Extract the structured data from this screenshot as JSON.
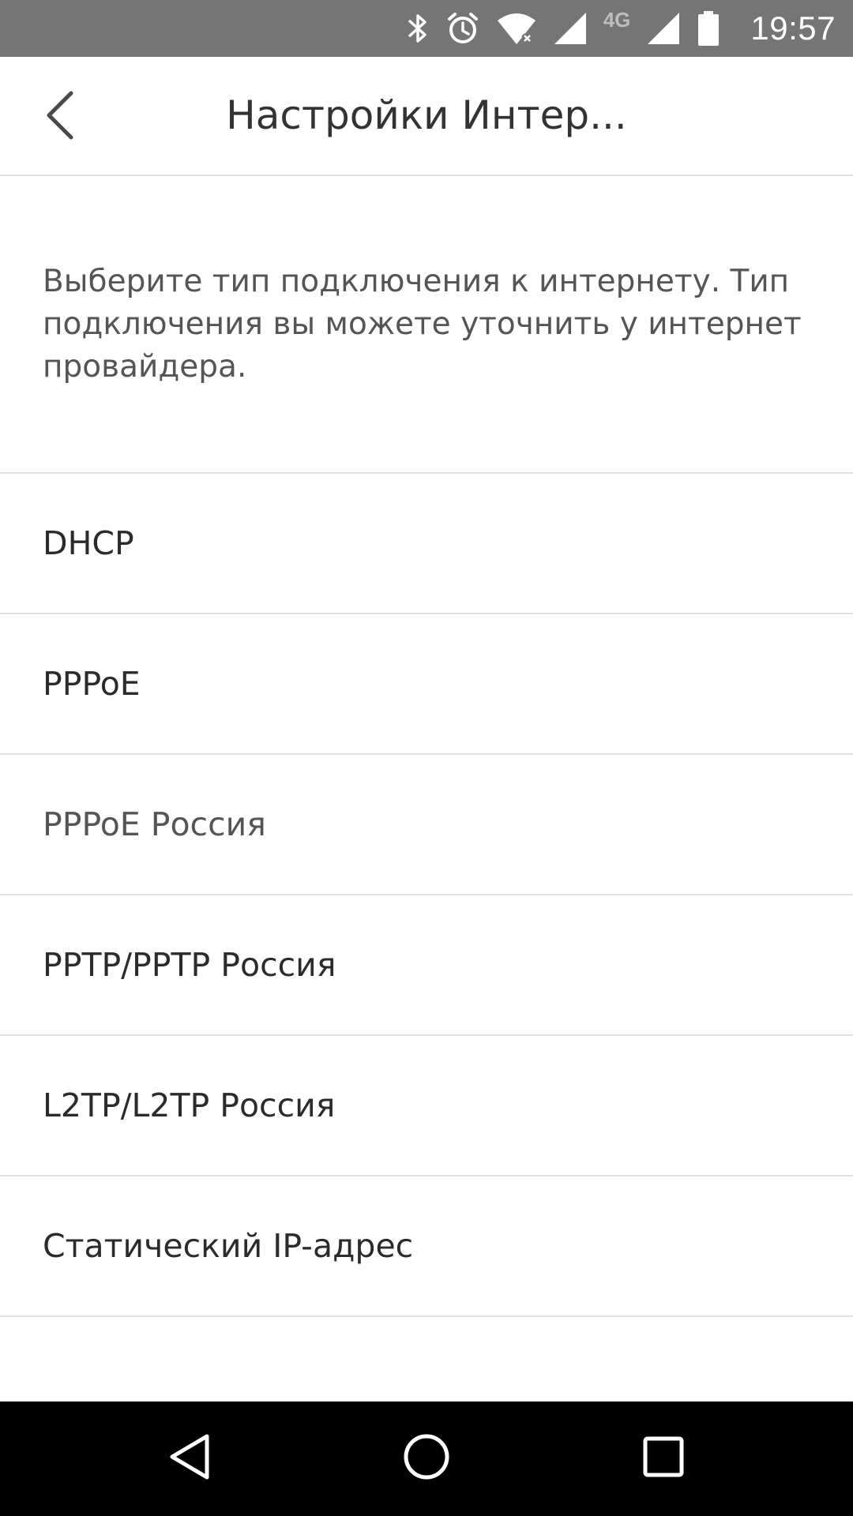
{
  "status_bar": {
    "time": "19:57",
    "network_label": "4G",
    "icons": [
      "bluetooth-icon",
      "alarm-icon",
      "wifi-icon",
      "signal-icon",
      "signal-icon",
      "battery-icon"
    ]
  },
  "app_bar": {
    "title": "Настройки Интер...",
    "back_icon": "chevron-left-icon"
  },
  "description": "Выберите тип подключения к интернету. Тип подключения вы можете уточнить у интернет провайдера.",
  "connection_types": [
    {
      "label": "DHCP"
    },
    {
      "label": "PPPoE"
    },
    {
      "label": "PPPoE Россия"
    },
    {
      "label": "PPTP/PPTP Россия"
    },
    {
      "label": "L2TP/L2TP Россия"
    },
    {
      "label": "Статический IP-адрес"
    }
  ],
  "nav_bar": {
    "icons": [
      "nav-back-icon",
      "nav-home-icon",
      "nav-recents-icon"
    ]
  },
  "colors": {
    "status_bar": "#757575",
    "nav_bar": "#000000",
    "divider": "#e1e1e1",
    "text": "#2b2b2b",
    "secondary_text": "#555555"
  }
}
